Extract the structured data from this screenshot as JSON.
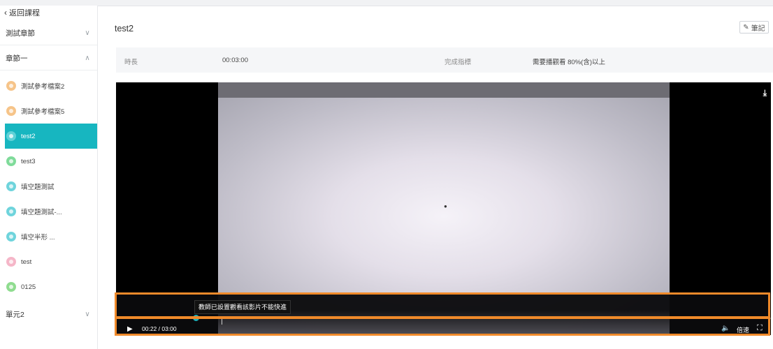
{
  "sidebar": {
    "back_label": "返回課程",
    "sections": [
      {
        "label": "測試章節",
        "expanded": false
      },
      {
        "label": "章節一",
        "expanded": true
      },
      {
        "label": "單元2",
        "expanded": false
      }
    ],
    "items": [
      {
        "label": "測試參考檔案2",
        "color": "#f6c489",
        "active": false
      },
      {
        "label": "測試參考檔案5",
        "color": "#f6c489",
        "active": false
      },
      {
        "label": "test2",
        "color": "#5fd1d7",
        "active": true
      },
      {
        "label": "test3",
        "color": "#7fdb9a",
        "active": false
      },
      {
        "label": "填空題測試",
        "color": "#6fd4dc",
        "active": false
      },
      {
        "label": "填空題測試-...",
        "color": "#6fd4dc",
        "active": false
      },
      {
        "label": "填空半形 ...",
        "color": "#6fd4dc",
        "active": false
      },
      {
        "label": "test",
        "color": "#f5b6c8",
        "active": false
      },
      {
        "label": "0125",
        "color": "#8fdc8f",
        "active": false
      }
    ]
  },
  "header": {
    "title": "test2",
    "notes_label": "筆記"
  },
  "info": {
    "duration_label": "時長",
    "duration_value": "00:03:00",
    "criteria_label": "完成指標",
    "criteria_value": "需要播觀看 80%(含)以上"
  },
  "player": {
    "tooltip": "教師已設置觀看該影片不能快進",
    "current_time": "00:22",
    "total_time": "03:00",
    "time_text": "00:22 / 03:00",
    "progress": 0.122,
    "speed_label": "倍速",
    "accent_color": "#1bb3bd"
  },
  "colors": {
    "active_item": "#17b6c0",
    "highlight": "#f08a2a"
  }
}
